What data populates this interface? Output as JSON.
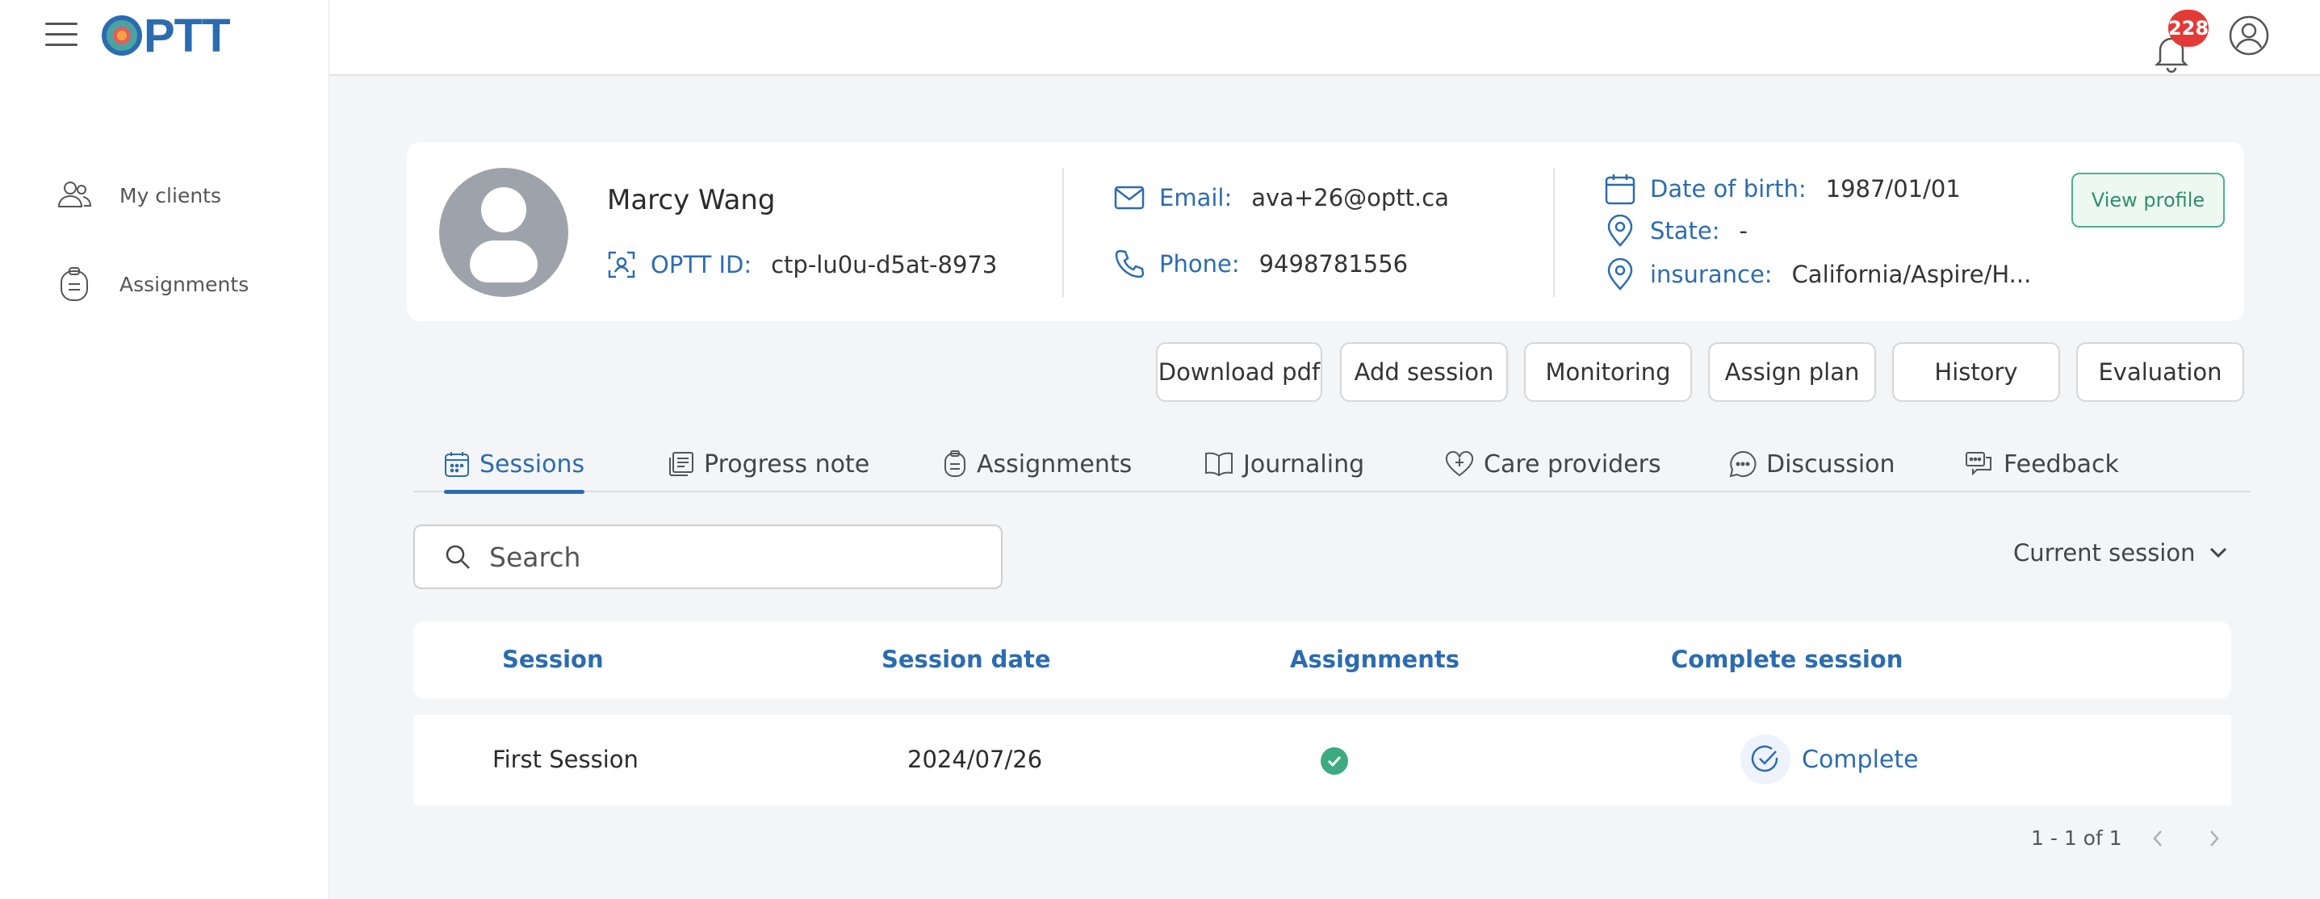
{
  "app": {
    "logo_text": "PTT"
  },
  "sidebar": {
    "items": [
      {
        "label": "My clients",
        "icon": "users-icon"
      },
      {
        "label": "Assignments",
        "icon": "clipboard-icon"
      }
    ]
  },
  "header": {
    "notification_count": "228"
  },
  "client": {
    "name": "Marcy Wang",
    "id_label": "OPTT ID:",
    "id_value": "ctp-lu0u-d5at-8973",
    "email_label": "Email:",
    "email_value": "ava+26@optt.ca",
    "phone_label": "Phone:",
    "phone_value": "9498781556",
    "dob_label": "Date of birth:",
    "dob_value": "1987/01/01",
    "state_label": "State:",
    "state_value": "-",
    "insurance_label": "insurance:",
    "insurance_value": "California/Aspire/H...",
    "view_profile_label": "View profile"
  },
  "actions": {
    "download_pdf": "Download pdf",
    "add_session": "Add session",
    "monitoring": "Monitoring",
    "assign_plan": "Assign plan",
    "history": "History",
    "evaluation": "Evaluation"
  },
  "tabs": [
    {
      "label": "Sessions",
      "active": true
    },
    {
      "label": "Progress note"
    },
    {
      "label": "Assignments"
    },
    {
      "label": "Journaling"
    },
    {
      "label": "Care providers"
    },
    {
      "label": "Discussion"
    },
    {
      "label": "Feedback"
    }
  ],
  "search": {
    "placeholder": "Search"
  },
  "session_filter": {
    "selected": "Current session"
  },
  "table": {
    "headers": [
      "Session",
      "Session date",
      "Assignments",
      "Complete session"
    ],
    "rows": [
      {
        "session": "First Session",
        "date": "2024/07/26",
        "assignments_done": true,
        "complete_label": "Complete"
      }
    ]
  },
  "pagination": {
    "range": "1 - 1 of 1"
  },
  "colors": {
    "accent": "#2b6cb0",
    "success": "#3eaa82",
    "badge": "#e53935"
  }
}
